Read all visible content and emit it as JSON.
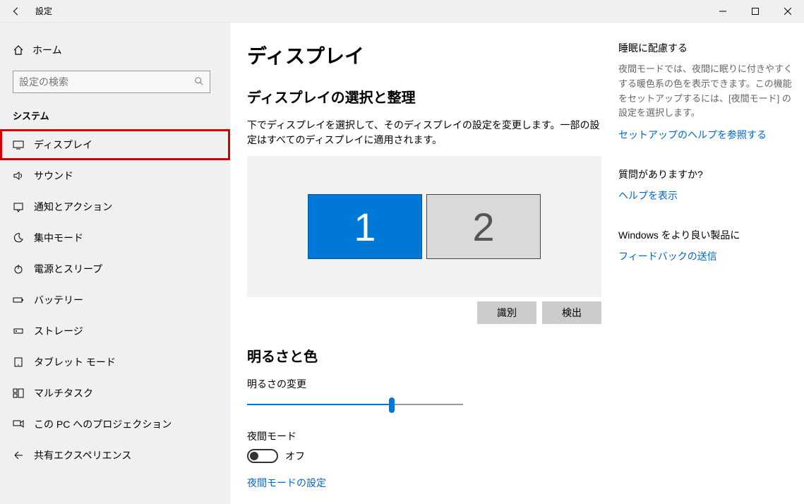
{
  "titlebar": {
    "title": "設定"
  },
  "sidebar": {
    "home": "ホーム",
    "search_placeholder": "設定の検索",
    "section": "システム",
    "items": [
      {
        "label": "ディスプレイ",
        "icon": "monitor",
        "selected": true
      },
      {
        "label": "サウンド",
        "icon": "sound"
      },
      {
        "label": "通知とアクション",
        "icon": "notification"
      },
      {
        "label": "集中モード",
        "icon": "moon"
      },
      {
        "label": "電源とスリープ",
        "icon": "power"
      },
      {
        "label": "バッテリー",
        "icon": "battery"
      },
      {
        "label": "ストレージ",
        "icon": "storage"
      },
      {
        "label": "タブレット モード",
        "icon": "tablet"
      },
      {
        "label": "マルチタスク",
        "icon": "multitask"
      },
      {
        "label": "この PC へのプロジェクション",
        "icon": "project"
      },
      {
        "label": "共有エクスペリエンス",
        "icon": "share"
      }
    ]
  },
  "main": {
    "h1": "ディスプレイ",
    "arrange": {
      "title": "ディスプレイの選択と整理",
      "desc": "下でディスプレイを選択して、そのディスプレイの設定を変更します。一部の設定はすべてのディスプレイに適用されます。",
      "monitors": [
        "1",
        "2"
      ],
      "identify": "識別",
      "detect": "検出"
    },
    "brightness": {
      "heading": "明るさと色",
      "label": "明るさの変更",
      "night_label": "夜間モード",
      "off": "オフ",
      "settings_link": "夜間モードの設定"
    }
  },
  "aside": {
    "sleep": {
      "title": "睡眠に配慮する",
      "text": "夜間モードでは、夜間に眠りに付きやすくする暖色系の色を表示できます。この機能をセットアップするには、[夜間モード] の設定を選択します。",
      "link": "セットアップのヘルプを参照する"
    },
    "questions": {
      "title": "質問がありますか?",
      "link": "ヘルプを表示"
    },
    "improve": {
      "title": "Windows をより良い製品に",
      "link": "フィードバックの送信"
    }
  }
}
